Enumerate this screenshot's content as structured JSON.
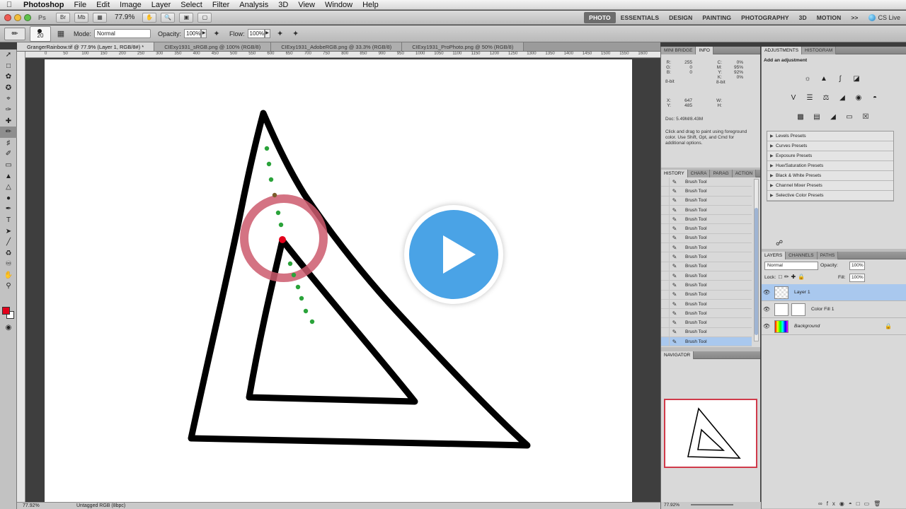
{
  "menubar": {
    "app": "Photoshop",
    "items": [
      "File",
      "Edit",
      "Image",
      "Layer",
      "Select",
      "Filter",
      "Analysis",
      "3D",
      "View",
      "Window",
      "Help"
    ]
  },
  "appbar": {
    "badge": "Ps",
    "zoom": "77.9%",
    "workspaces": [
      "PHOTO",
      "ESSENTIALS",
      "DESIGN",
      "PAINTING",
      "PHOTOGRAPHY",
      "3D",
      "MOTION"
    ],
    "active_workspace": "PHOTO",
    "more": ">>",
    "cs_live": "CS Live"
  },
  "options": {
    "brush_size": "20",
    "mode_label": "Mode:",
    "mode_value": "Normal",
    "opacity_label": "Opacity:",
    "opacity_value": "100%",
    "flow_label": "Flow:",
    "flow_value": "100%"
  },
  "doc_tabs": [
    {
      "label": "GrangerRainbow.tif @ 77.9% (Layer 1, RGB/8#) *",
      "active": true
    },
    {
      "label": "CIExy1931_sRGB.png @ 100% (RGB/8)",
      "active": false
    },
    {
      "label": "CIExy1931_AdobeRGB.png @ 33.3% (RGB/8)",
      "active": false
    },
    {
      "label": "CIExy1931_ProPhoto.png @ 50% (RGB/8)",
      "active": false
    }
  ],
  "ruler_ticks": [
    "0",
    "50",
    "100",
    "150",
    "200",
    "250",
    "300",
    "350",
    "400",
    "450",
    "500",
    "550",
    "600",
    "650",
    "700",
    "750",
    "800",
    "850",
    "900",
    "950",
    "1000",
    "1050",
    "1100",
    "1150",
    "1200",
    "1250",
    "1300",
    "1350",
    "1400",
    "1450",
    "1500",
    "1550",
    "1600"
  ],
  "status": {
    "zoom": "77.92%",
    "doc": "Untagged RGB (8bpc)"
  },
  "info_panel": {
    "tabs": [
      "MINI BRIDGE",
      "INFO"
    ],
    "rgb": [
      {
        "l": "R:",
        "v": "255"
      },
      {
        "l": "G:",
        "v": "0"
      },
      {
        "l": "B:",
        "v": "0"
      }
    ],
    "cmyk": [
      {
        "l": "C:",
        "v": "0%"
      },
      {
        "l": "M:",
        "v": "95%"
      },
      {
        "l": "Y:",
        "v": "92%"
      },
      {
        "l": "K:",
        "v": "0%"
      }
    ],
    "bit_left": "8-bit",
    "bit_right": "8-bit",
    "xy": [
      {
        "l": "X:",
        "v": "647"
      },
      {
        "l": "Y:",
        "v": "485"
      }
    ],
    "wh": [
      {
        "l": "W:",
        "v": ""
      },
      {
        "l": "H:",
        "v": ""
      }
    ],
    "doc": "Doc: 5.49M/8.43M",
    "hint": "Click and drag to paint using foreground color.  Use Shift, Opt, and Cmd for additional options."
  },
  "history_panel": {
    "tabs": [
      "HISTORY",
      "CHARA",
      "PARAG",
      "ACTION"
    ],
    "items": [
      "Brush Tool",
      "Brush Tool",
      "Brush Tool",
      "Brush Tool",
      "Brush Tool",
      "Brush Tool",
      "Brush Tool",
      "Brush Tool",
      "Brush Tool",
      "Brush Tool",
      "Brush Tool",
      "Brush Tool",
      "Brush Tool",
      "Brush Tool",
      "Brush Tool",
      "Brush Tool",
      "Brush Tool",
      "Brush Tool"
    ],
    "selected_index": 17
  },
  "navigator_panel": {
    "tabs": [
      "NAVIGATOR"
    ],
    "zoom": "77.92%"
  },
  "adjustments_panel": {
    "tabs": [
      "ADJUSTMENTS",
      "HISTOGRAM"
    ],
    "title": "Add an adjustment",
    "presets": [
      "Levels Presets",
      "Curves Presets",
      "Exposure Presets",
      "Hue/Saturation Presets",
      "Black & White Presets",
      "Channel Mixer Presets",
      "Selective Color Presets"
    ]
  },
  "layers_panel": {
    "tabs": [
      "LAYERS",
      "CHANNELS",
      "PATHS"
    ],
    "blend": "Normal",
    "opacity_label": "Opacity:",
    "opacity_value": "100%",
    "lock_label": "Lock:",
    "fill_label": "Fill:",
    "fill_value": "100%",
    "layers": [
      {
        "name": "Layer 1",
        "selected": true
      },
      {
        "name": "Color Fill 1",
        "selected": false
      },
      {
        "name": "Background",
        "selected": false
      }
    ]
  },
  "colors": {
    "foreground": "#e3001b",
    "play_button": "#4aa3e6",
    "selection": "#a9c8ee"
  }
}
